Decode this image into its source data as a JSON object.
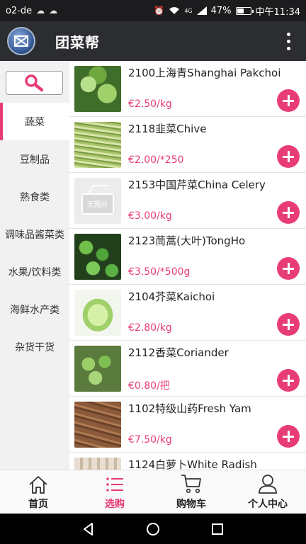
{
  "status_bar": {
    "carrier": "o2-de",
    "network_type": "4G",
    "battery": "47%",
    "time": "中午11:34"
  },
  "app_bar": {
    "title": "团菜帮"
  },
  "sidebar": {
    "categories": [
      {
        "label": "蔬菜",
        "active": true
      },
      {
        "label": "豆制品",
        "active": false
      },
      {
        "label": "熟食类",
        "active": false
      },
      {
        "label": "调味品酱菜类",
        "active": false
      },
      {
        "label": "水果/饮料类",
        "active": false
      },
      {
        "label": "海鲜水产类",
        "active": false
      },
      {
        "label": "杂货干货",
        "active": false
      }
    ]
  },
  "products": [
    {
      "name": "2100上海青Shanghai Pakchoi",
      "price": "€2.50/kg"
    },
    {
      "name": "2118韭菜Chive",
      "price": "€2.00/*250"
    },
    {
      "name": "2153中国芹菜China Celery",
      "price": "€3.00/kg",
      "placeholder_text": "无图片"
    },
    {
      "name": "2123茼蒿(大叶)TongHo",
      "price": "€3.50/*500g"
    },
    {
      "name": "2104芥菜Kaichoi",
      "price": "€2.80/kg"
    },
    {
      "name": "2112香菜Coriander",
      "price": "€0.80/把"
    },
    {
      "name": "1102特级山药Fresh Yam",
      "price": "€7.50/kg"
    },
    {
      "name": "1124白萝卜White Radish",
      "price": ""
    }
  ],
  "tab_bar": {
    "tabs": [
      {
        "label": "首页",
        "icon": "home-icon"
      },
      {
        "label": "选购",
        "icon": "list-icon",
        "active": true
      },
      {
        "label": "购物车",
        "icon": "cart-icon"
      },
      {
        "label": "个人中心",
        "icon": "person-icon"
      }
    ]
  },
  "colors": {
    "accent": "#e83c78",
    "app_bar": "#2b2d30",
    "sidebar": "#f1f1f1"
  }
}
